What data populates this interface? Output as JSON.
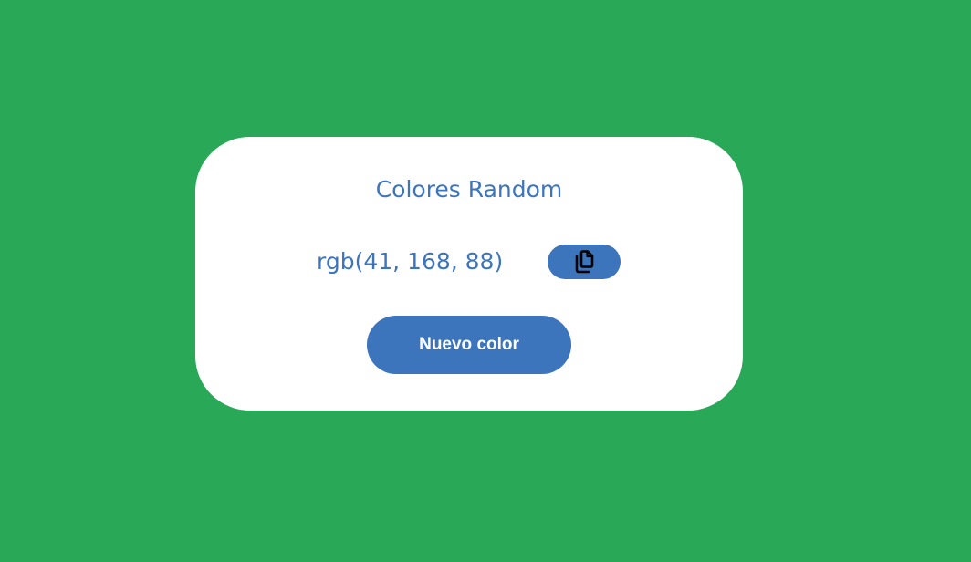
{
  "page": {
    "background_color": "#29a858"
  },
  "card": {
    "title": "Colores Random",
    "color_text": "rgb(41, 168, 88)",
    "copy_button": {
      "icon": "copy-icon",
      "color": "#3d75bc"
    },
    "new_color_button": {
      "label": "Nuevo color",
      "color": "#3d75bc"
    },
    "accent_color": "#3d75bc"
  }
}
